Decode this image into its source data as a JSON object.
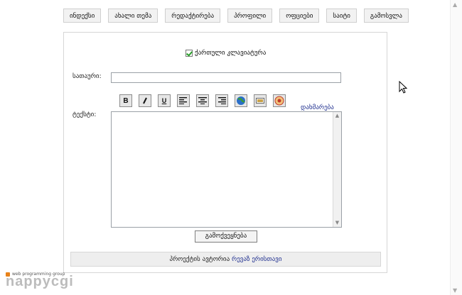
{
  "nav": {
    "items": [
      "ინდექსი",
      "ახალი თემა",
      "რედაქტირება",
      "პროფილი",
      "ოფციები",
      "საიტი",
      "გამოსვლა"
    ]
  },
  "keyboard": {
    "label": "ქართული კლავიატურა",
    "checked": true
  },
  "form": {
    "title_label": "სათაური:",
    "title_value": "",
    "body_label": "ტექსტი:",
    "help_link": "დახმარება",
    "submit_label": "გამოქვეყნება",
    "toolbar": [
      {
        "name": "bold-button",
        "glyph": "B"
      },
      {
        "name": "italic-button",
        "glyph": "/"
      },
      {
        "name": "underline-button",
        "glyph": "U"
      },
      {
        "name": "align-left-button",
        "glyph": "≡"
      },
      {
        "name": "align-center-button",
        "glyph": "≡"
      },
      {
        "name": "align-right-button",
        "glyph": "≡"
      },
      {
        "name": "link-globe-button",
        "glyph": "🌐"
      },
      {
        "name": "image-button",
        "glyph": "▭"
      },
      {
        "name": "smiley-button",
        "glyph": "✿"
      }
    ]
  },
  "footer": {
    "text": "პროექტის ავტორია",
    "author": "რევაზ ერისთავი"
  },
  "logo": {
    "small": "web programming group",
    "main": "nappycgi"
  },
  "colors": {
    "link": "#1f2f8f",
    "checkmark": "#2aa02a",
    "logo_dot": "#e8821a"
  }
}
